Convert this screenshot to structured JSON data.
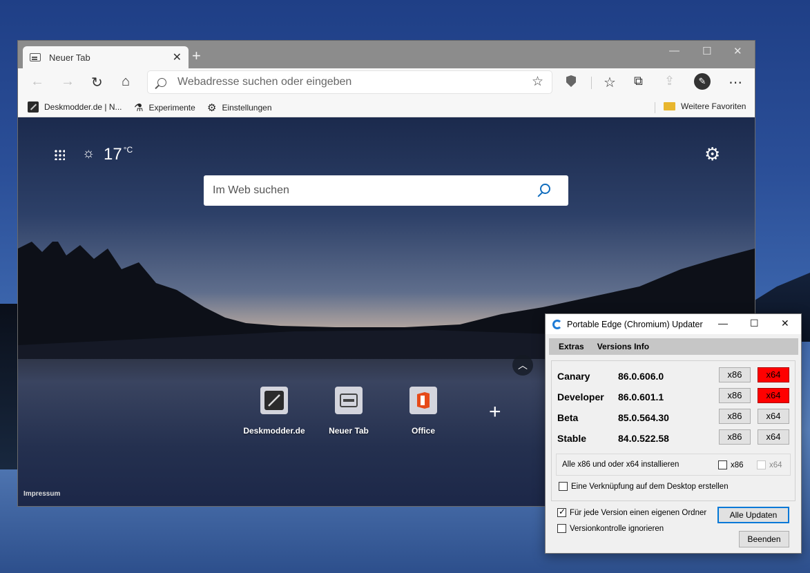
{
  "browser": {
    "tab_title": "Neuer Tab",
    "address_placeholder": "Webadresse suchen oder eingeben",
    "favorites": [
      {
        "label": "Deskmodder.de | N..."
      },
      {
        "label": "Experimente"
      },
      {
        "label": "Einstellungen"
      }
    ],
    "other_favorites": "Weitere Favoriten"
  },
  "newtab": {
    "temperature": "17",
    "temperature_unit": "°C",
    "search_placeholder": "Im Web suchen",
    "tiles": [
      {
        "label": "Deskmodder.de"
      },
      {
        "label": "Neuer Tab"
      },
      {
        "label": "Office"
      }
    ],
    "footer_link": "Impressum"
  },
  "updater": {
    "title": "Portable Edge (Chromium) Updater",
    "menu": [
      "Extras",
      "Versions Info"
    ],
    "versions": [
      {
        "name": "Canary",
        "version": "86.0.606.0",
        "x86": "x86",
        "x64": "x64",
        "x64_highlight": true
      },
      {
        "name": "Developer",
        "version": "86.0.601.1",
        "x86": "x86",
        "x64": "x64",
        "x64_highlight": true
      },
      {
        "name": "Beta",
        "version": "85.0.564.30",
        "x86": "x86",
        "x64": "x64",
        "x64_highlight": false
      },
      {
        "name": "Stable",
        "version": "84.0.522.58",
        "x86": "x86",
        "x64": "x64",
        "x64_highlight": false
      }
    ],
    "install_all_label": "Alle x86 und oder x64 installieren",
    "install_x86": "x86",
    "install_x64": "x64",
    "shortcut_label": "Eine Verknüpfung auf dem Desktop erstellen",
    "own_folder_label": "Für jede Version einen eigenen Ordner",
    "ignore_version_label": "Versionkontrolle ignorieren",
    "update_all_button": "Alle Updaten",
    "quit_button": "Beenden"
  },
  "colors": {
    "highlight_red": "#ff0000",
    "accent_blue": "#0078d7"
  }
}
